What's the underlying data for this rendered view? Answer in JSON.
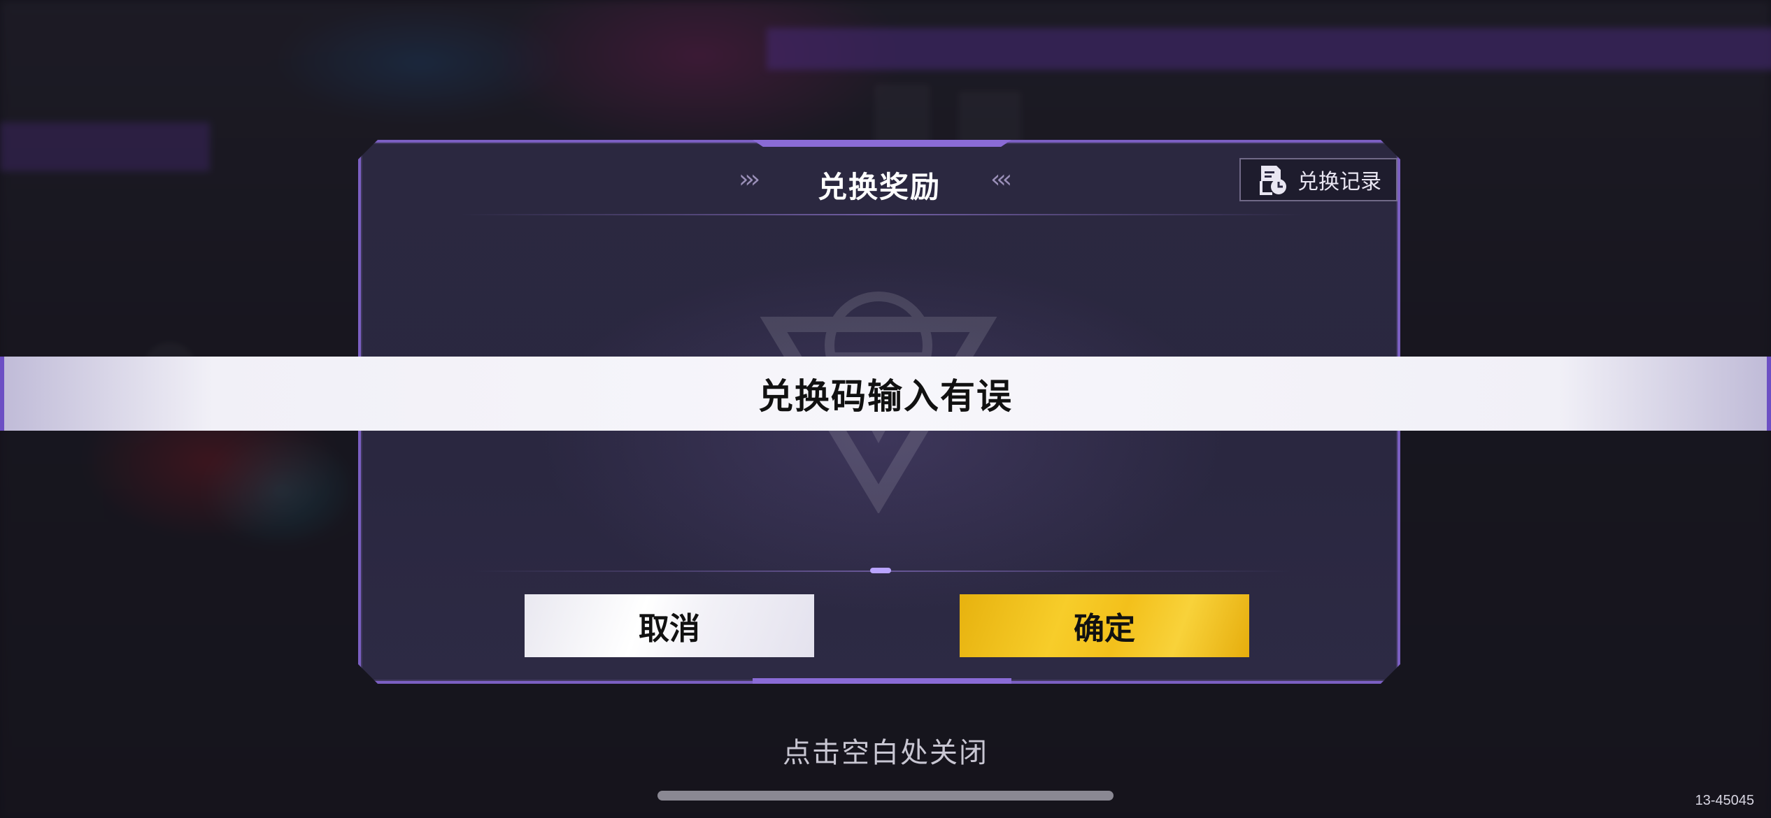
{
  "dialog": {
    "title": "兑换奖励",
    "title_chevrons_left": "›››",
    "title_chevrons_right": "‹‹‹",
    "history_button": "兑换记录",
    "cancel_button": "取消",
    "confirm_button": "确定"
  },
  "toast": {
    "message": "兑换码输入有误"
  },
  "footer": {
    "close_hint": "点击空白处关闭",
    "build_id": "13-45045"
  },
  "icons": {
    "history": "document-clock-icon",
    "emblem": "emblem-icon"
  },
  "colors": {
    "dialog_border": "#7b5fc2",
    "confirm_yellow": "#f3c01b",
    "toast_bg": "#f3f2f8"
  }
}
